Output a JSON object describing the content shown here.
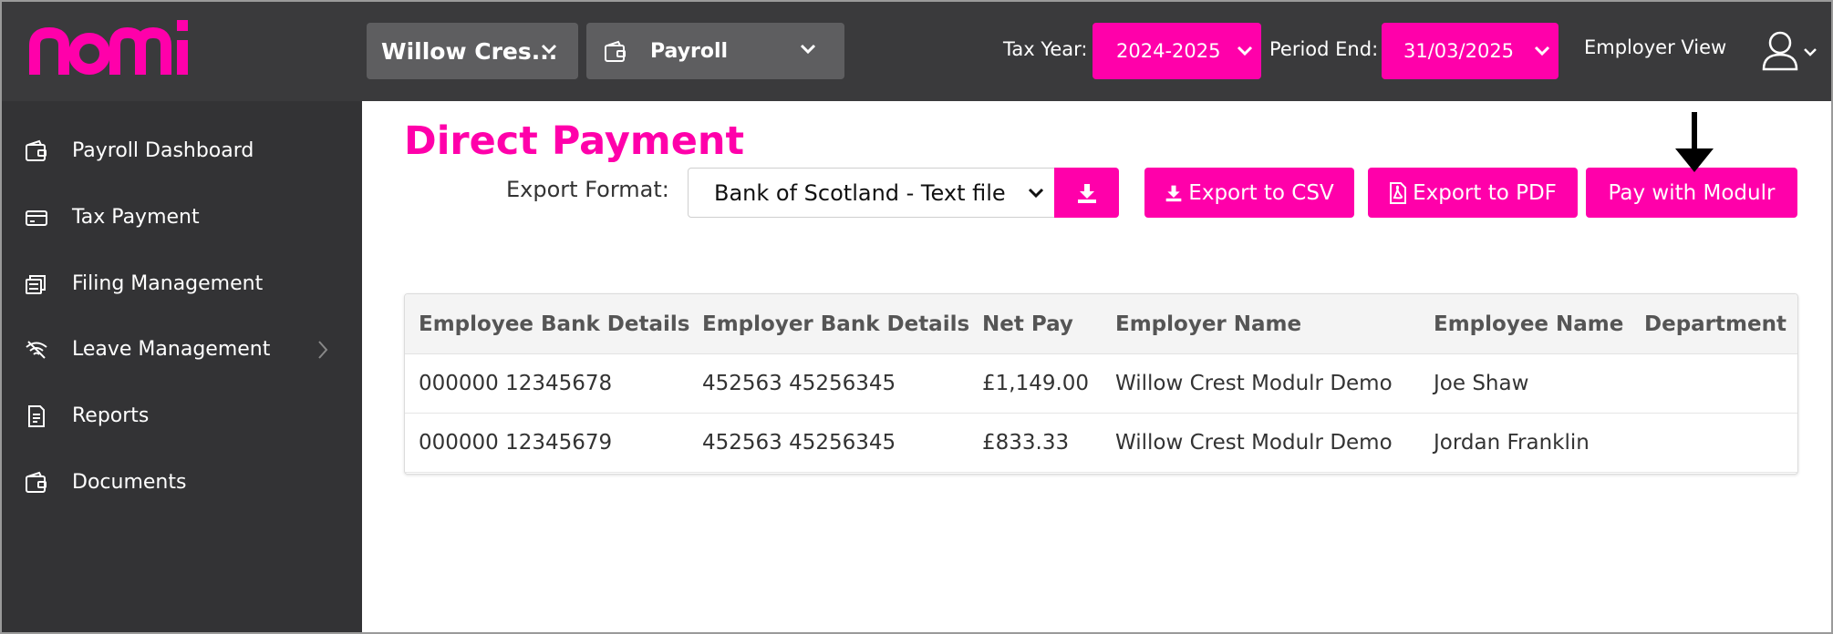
{
  "brand": {
    "logo_text": "nomi",
    "color": "#ff00aa"
  },
  "header": {
    "company": "Willow Cres...",
    "module": "Payroll",
    "tax_year_label": "Tax Year:",
    "tax_year": "2024-2025",
    "period_end_label": "Period End:",
    "period_end": "31/03/2025",
    "view": "Employer View"
  },
  "sidebar": {
    "items": [
      {
        "label": "Payroll Dashboard",
        "icon": "wallet-icon"
      },
      {
        "label": "Tax Payment",
        "icon": "card-icon"
      },
      {
        "label": "Filing Management",
        "icon": "files-icon"
      },
      {
        "label": "Leave Management",
        "icon": "wifi-off-icon",
        "has_submenu": true
      },
      {
        "label": "Reports",
        "icon": "report-icon"
      },
      {
        "label": "Documents",
        "icon": "wallet-icon"
      }
    ]
  },
  "main": {
    "title": "Direct Payment",
    "export_format_label": "Export Format:",
    "export_format_value": "Bank of Scotland - Text file",
    "export_csv": "Export to CSV",
    "export_pdf": "Export to PDF",
    "pay_modulr": "Pay with Modulr"
  },
  "table": {
    "columns": [
      "Employee Bank Details",
      "Employer Bank Details",
      "Net Pay",
      "Employer Name",
      "Employee Name",
      "Department"
    ],
    "rows": [
      [
        "000000 12345678",
        "452563 45256345",
        "£1,149.00",
        "Willow Crest Modulr Demo",
        "Joe Shaw",
        ""
      ],
      [
        "000000 12345679",
        "452563 45256345",
        "£833.33",
        "Willow Crest Modulr Demo",
        "Jordan Franklin",
        ""
      ]
    ]
  }
}
